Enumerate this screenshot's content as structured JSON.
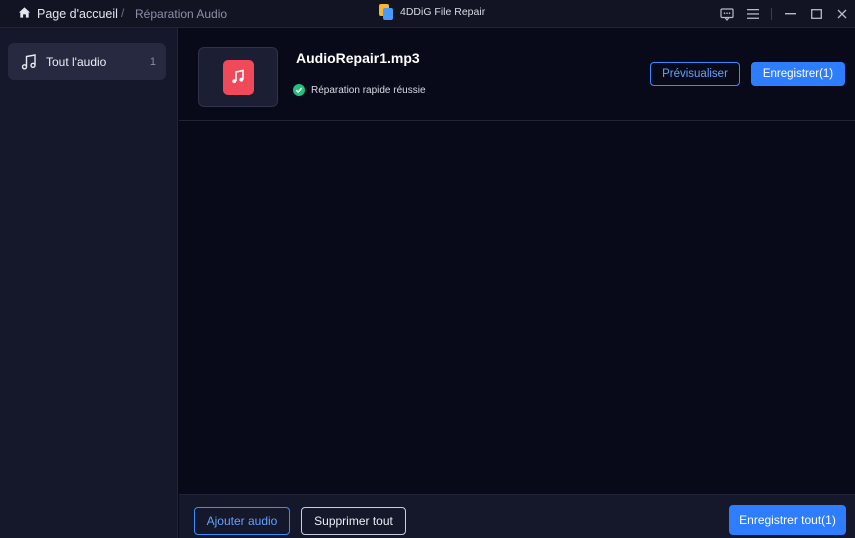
{
  "titlebar": {
    "home_label": "Page d'accueil",
    "separator": "/",
    "current_label": "Réparation Audio",
    "app_title": "4DDiG File Repair",
    "icons": [
      "home-icon",
      "feedback-icon",
      "menu-icon",
      "minimize-icon",
      "maximize-icon",
      "close-icon"
    ]
  },
  "sidebar": {
    "items": [
      {
        "label": "Tout l'audio",
        "count": "1",
        "icon": "music-note-icon"
      }
    ]
  },
  "file": {
    "name": "AudioRepair1.mp3",
    "status": "Réparation rapide réussie",
    "status_icon": "check-circle-icon",
    "preview_label": "Prévisualiser",
    "save_label": "Enregistrer(1)"
  },
  "bottom": {
    "add_label": "Ajouter audio",
    "delete_label": "Supprimer tout",
    "save_all_label": "Enregistrer tout(1)"
  },
  "colors": {
    "accent": "#2f7dff",
    "audio_tile": "#f04a5a",
    "success": "#22c07a",
    "background": "#080a19"
  }
}
